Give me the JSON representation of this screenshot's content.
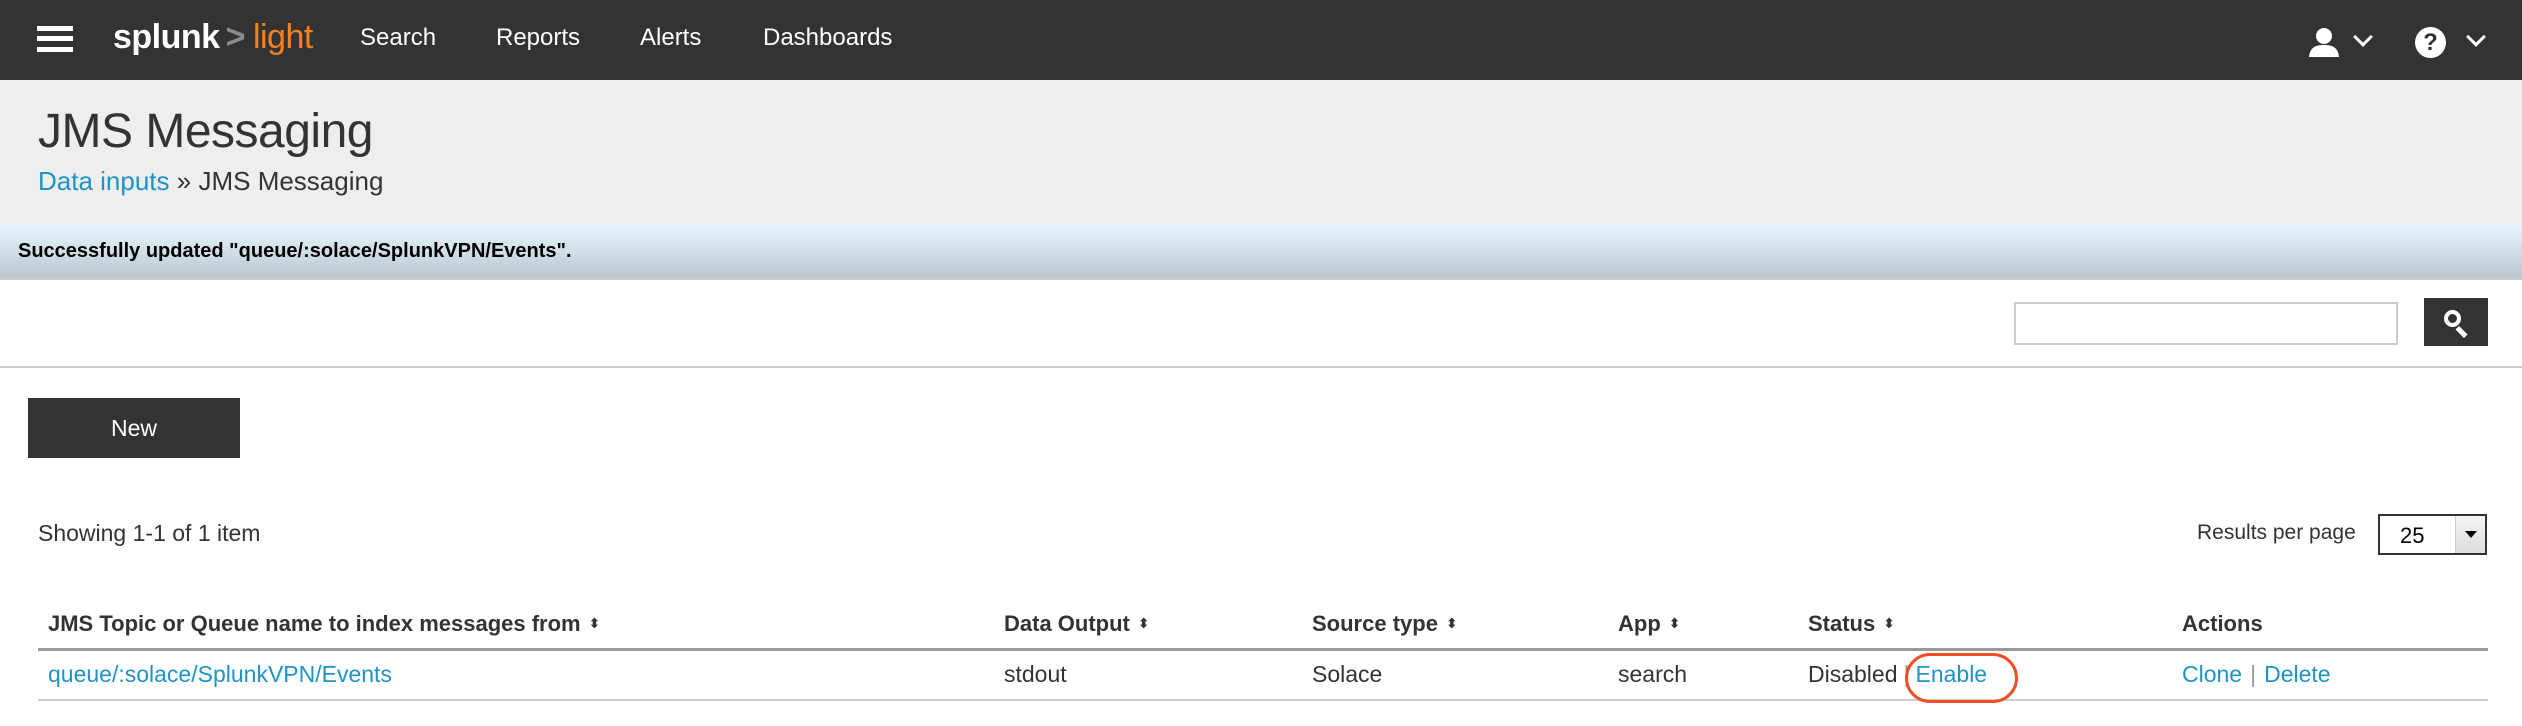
{
  "topbar": {
    "logo": {
      "brand": "splunk",
      "chevron": ">",
      "product": "light"
    },
    "nav": [
      "Search",
      "Reports",
      "Alerts",
      "Dashboards"
    ],
    "icons": {
      "menu": "hamburger-menu-icon",
      "user": "user-icon",
      "help": "help-icon"
    }
  },
  "page": {
    "title": "JMS Messaging",
    "breadcrumb": {
      "parent": "Data inputs",
      "separator": "»",
      "current": "JMS Messaging"
    }
  },
  "message": "Successfully updated \"queue/:solace/SplunkVPN/Events\".",
  "filter": {
    "value": "",
    "placeholder": ""
  },
  "actions": {
    "new_label": "New"
  },
  "pagination": {
    "summary": "Showing 1-1 of 1 item",
    "results_per_page_label": "Results per page",
    "results_per_page_value": "25"
  },
  "table": {
    "columns": [
      {
        "label": "JMS Topic or Queue name to index messages from",
        "sortable": true
      },
      {
        "label": "Data Output",
        "sortable": true
      },
      {
        "label": "Source type",
        "sortable": true
      },
      {
        "label": "App",
        "sortable": true
      },
      {
        "label": "Status",
        "sortable": true
      },
      {
        "label": "Actions",
        "sortable": false
      }
    ],
    "sort_glyph": "⬍",
    "rows": [
      {
        "name": "queue/:solace/SplunkVPN/Events",
        "data_output": "stdout",
        "source_type": "Solace",
        "app": "search",
        "status": "Disabled",
        "status_action": "Enable",
        "actions": [
          "Clone",
          "Delete"
        ]
      }
    ],
    "separator": "|"
  },
  "colors": {
    "accent_link": "#1e93c6",
    "brand_orange": "#f58220",
    "highlight": "#f04e23",
    "topbar": "#333333"
  }
}
